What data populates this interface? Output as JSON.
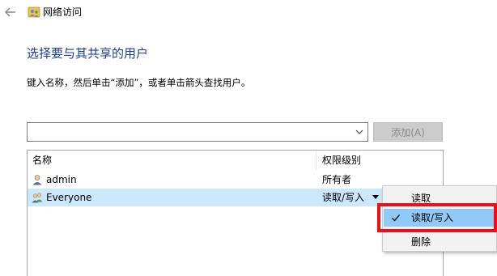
{
  "window": {
    "title": "网络访问",
    "back_icon": "arrow-left-icon",
    "app_icon": "network-share-icon"
  },
  "page": {
    "heading": "选择要与其共享的用户",
    "instruction": "键入名称，然后单击“添加”，或者单击箭头查找用户。"
  },
  "name_input": {
    "value": "",
    "placeholder": "",
    "dropdown_icon": "chevron-down-icon"
  },
  "add_button": {
    "label": "添加(A)",
    "enabled": false
  },
  "user_list": {
    "columns": [
      "名称",
      "权限级别"
    ],
    "rows": [
      {
        "name": "admin",
        "permission": "所有者",
        "icon": "user-icon",
        "selected": false
      },
      {
        "name": "Everyone",
        "permission": "读取/写入",
        "icon": "group-icon",
        "selected": true
      }
    ]
  },
  "permission_menu": {
    "items": [
      {
        "label": "读取",
        "checked": false
      },
      {
        "label": "读取/写入",
        "checked": true
      },
      {
        "label": "删除",
        "checked": false
      }
    ],
    "check_icon": "checkmark-icon"
  },
  "colors": {
    "heading": "#1e3f8c",
    "selected_row": "#cce8ff",
    "menu_checked": "#91c9f7",
    "annotation": "#e8101b"
  }
}
